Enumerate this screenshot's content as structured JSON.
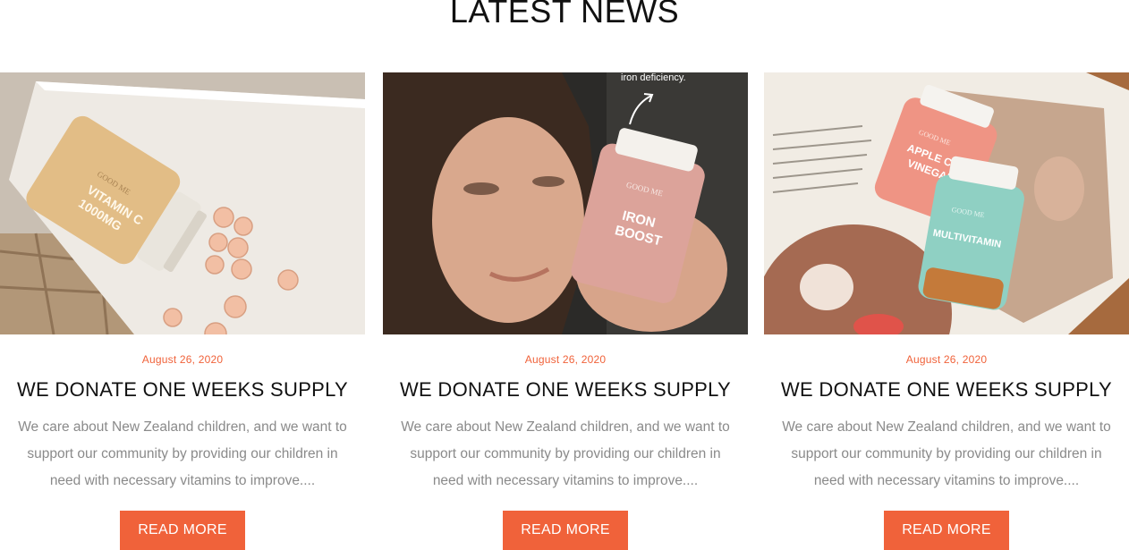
{
  "section": {
    "title": "LATEST NEWS"
  },
  "posts": [
    {
      "date": "August 26, 2020",
      "title": "WE DONATE ONE WEEKS SUPPLY",
      "excerpt": "We care about New Zealand children, and we want to support our community by providing our children in need with necessary vitamins to improve....",
      "button": "READ MORE",
      "image": {
        "brand": "GOOD ME",
        "label_line1": "VITAMIN C",
        "label_line2": "1000MG"
      }
    },
    {
      "date": "August 26, 2020",
      "title": "WE DONATE ONE WEEKS SUPPLY",
      "excerpt": "We care about New Zealand children, and we want to support our community by providing our children in need with necessary vitamins to improve....",
      "button": "READ MORE",
      "image": {
        "caption": "iron deficiency.",
        "brand": "GOOD ME",
        "label_line1": "IRON",
        "label_line2": "BOOST"
      }
    },
    {
      "date": "August 26, 2020",
      "title": "WE DONATE ONE WEEKS SUPPLY",
      "excerpt": "We care about New Zealand children, and we want to support our community by providing our children in need with necessary vitamins to improve....",
      "button": "READ MORE",
      "image": {
        "brand_a": "GOOD ME",
        "label_a_line1": "APPLE CIDER",
        "label_a_line2": "VINEGAR",
        "brand_b": "GOOD ME",
        "label_b": "MULTIVITAMIN"
      }
    }
  ],
  "colors": {
    "accent": "#f0623a",
    "text": "#111111",
    "muted": "#8a8a8a"
  }
}
